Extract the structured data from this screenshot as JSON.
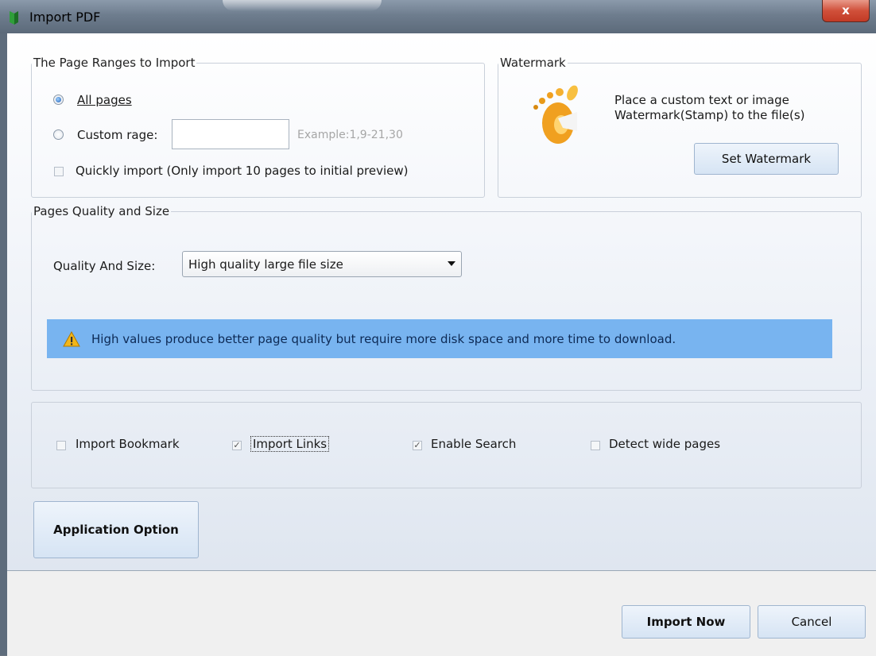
{
  "window": {
    "title": "Import PDF",
    "close_label": "x"
  },
  "page_ranges": {
    "legend": "The Page Ranges to Import",
    "all_pages_label": "All pages",
    "all_pages_selected": true,
    "custom_label": "Custom rage:",
    "custom_value": "",
    "custom_example": "Example:1,9-21,30",
    "quick_import_label": "Quickly import (Only import 10 pages to  initial  preview)",
    "quick_import_checked": false
  },
  "watermark": {
    "legend": "Watermark",
    "desc_line1": "Place a custom text or image",
    "desc_line2": "Watermark(Stamp) to the file(s)",
    "button_label": "Set Watermark",
    "icon": "gimp-icon"
  },
  "quality": {
    "legend": "Pages Quality and Size",
    "label": "Quality And Size:",
    "selected": "High quality large file size",
    "info_text": "High values produce better page quality but require more disk space and more time to download.",
    "info_color": "#78b4f0"
  },
  "options": {
    "import_bookmark": {
      "label": "Import Bookmark",
      "checked": false
    },
    "import_links": {
      "label": "Import Links",
      "checked": true
    },
    "enable_search": {
      "label": "Enable Search",
      "checked": true
    },
    "detect_wide": {
      "label": "Detect wide pages",
      "checked": false
    }
  },
  "application_option_label": "Application Option",
  "footer": {
    "import_label": "Import Now",
    "cancel_label": "Cancel"
  }
}
